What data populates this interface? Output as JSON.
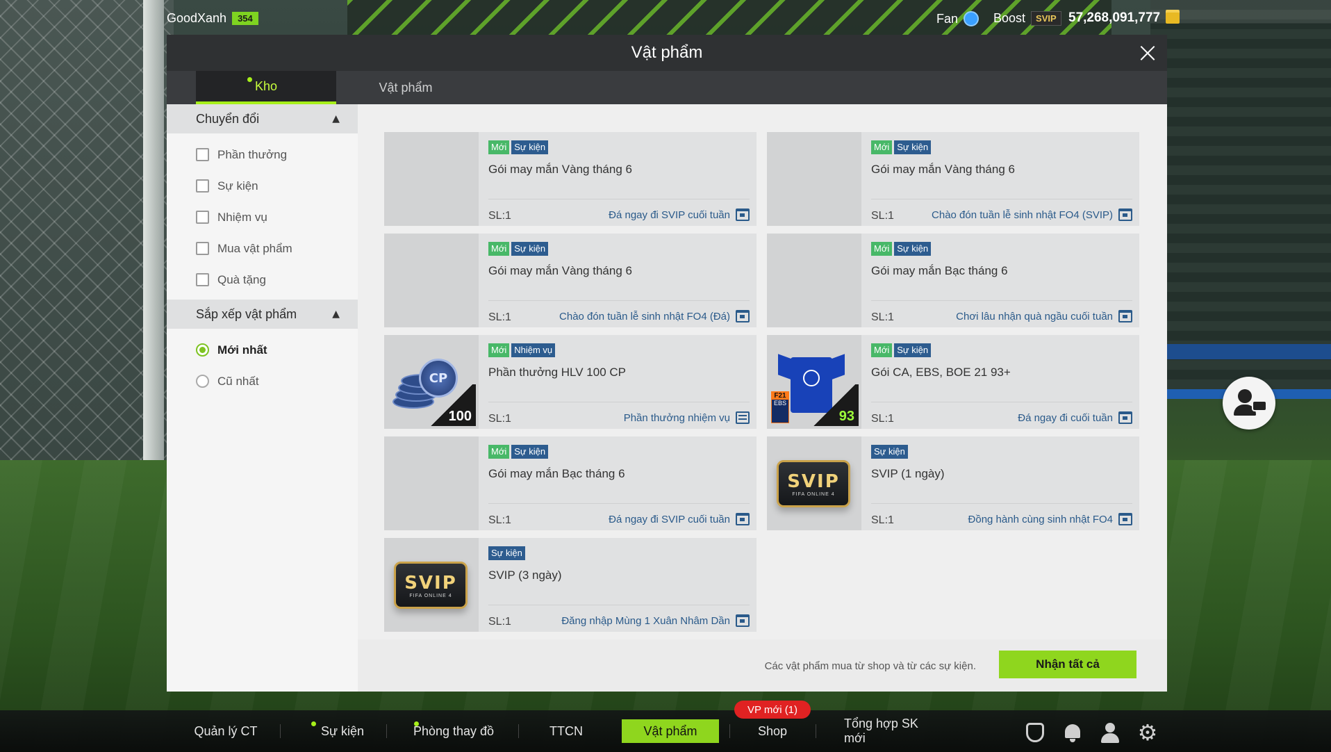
{
  "topbar": {
    "username": "GoodXanh",
    "level": "354",
    "fan_label": "Fan",
    "boost_label": "Boost",
    "boost_badge": "SVIP",
    "coins": "57,268,091,777"
  },
  "modal": {
    "title": "Vật phẩm",
    "close_icon": "close-icon",
    "tabs": [
      {
        "label": "Kho",
        "active": true,
        "has_dot": true
      },
      {
        "label": "Vật phẩm",
        "active": false
      }
    ]
  },
  "sidebar": {
    "filter_section": {
      "label": "Chuyển đổi",
      "options": [
        "Phần thưởng",
        "Sự kiện",
        "Nhiệm vụ",
        "Mua vật phẩm",
        "Quà tặng"
      ]
    },
    "sort_section": {
      "label": "Sắp xếp vật phẩm",
      "options": [
        "Mới nhất",
        "Cũ nhất"
      ],
      "selected": "Mới nhất"
    }
  },
  "tag_labels": {
    "new": "Mới",
    "event": "Sự kiện",
    "mission": "Nhiệm vụ"
  },
  "items": [
    {
      "tags": [
        "Mới",
        "Sự kiện"
      ],
      "title": "Gói may mắn Vàng tháng 6",
      "qty": "SL:1",
      "source": "Đá ngay đi SVIP cuối tuần",
      "thumb": "blank"
    },
    {
      "tags": [
        "Mới",
        "Sự kiện"
      ],
      "title": "Gói may mắn Vàng tháng 6",
      "qty": "SL:1",
      "source": "Chào đón tuần lễ sinh nhật FO4 (SVIP)",
      "thumb": "blank"
    },
    {
      "tags": [
        "Mới",
        "Sự kiện"
      ],
      "title": "Gói may mắn Vàng tháng 6",
      "qty": "SL:1",
      "source": "Chào đón tuần lễ sinh nhật FO4 (Đá)",
      "thumb": "blank"
    },
    {
      "tags": [
        "Mới",
        "Sự kiện"
      ],
      "title": "Gói may mắn Bạc tháng 6",
      "qty": "SL:1",
      "source": "Chơi lâu nhận quà ngầu cuối tuần",
      "thumb": "blank"
    },
    {
      "tags": [
        "Mới",
        "Nhiệm vụ"
      ],
      "title": "Phần thưởng HLV 100 CP",
      "qty": "SL:1",
      "source": "Phần thưởng nhiệm vụ",
      "thumb": "cp",
      "thumb_number": "100"
    },
    {
      "tags": [
        "Mới",
        "Sự kiện"
      ],
      "title": "Gói CA, EBS, BOE 21 93+",
      "qty": "SL:1",
      "source": "Đá ngay đi cuối tuần",
      "thumb": "shirt",
      "thumb_number": "93",
      "season": "F21",
      "season_sub": "EBS"
    },
    {
      "tags": [
        "Mới",
        "Sự kiện"
      ],
      "title": "Gói may mắn Bạc tháng 6",
      "qty": "SL:1",
      "source": "Đá ngay đi SVIP cuối tuần",
      "thumb": "blank"
    },
    {
      "tags": [
        "Sự kiện"
      ],
      "title": "SVIP (1 ngày)",
      "qty": "SL:1",
      "source": "Đồng hành cùng sinh nhật FO4",
      "thumb": "svip",
      "svip_text": "SVIP",
      "svip_sub": "FIFA ONLINE 4"
    },
    {
      "tags": [
        "Sự kiện"
      ],
      "title": "SVIP (3 ngày)",
      "qty": "SL:1",
      "source": "Đăng nhập Mùng 1 Xuân Nhâm Dần",
      "thumb": "svip",
      "svip_text": "SVIP",
      "svip_sub": "FIFA ONLINE 4"
    }
  ],
  "footer": {
    "note": "Các vật phẩm mua từ shop và từ các sự kiện.",
    "claim_all": "Nhận tất cả"
  },
  "bottom_nav": {
    "items": [
      "Quản lý CT",
      "Sự kiện",
      "Phòng thay đồ",
      "TTCN",
      "Vật phẩm",
      "Shop",
      "Tổng hợp SK mới"
    ],
    "active": "Vật phẩm",
    "badge": "VP mới (1)"
  },
  "colors": {
    "accent": "#8fd61e",
    "header_bg": "#2f3133",
    "tag_new": "#48b868",
    "tag_event": "#2d5c8f",
    "badge_red": "#e02222"
  }
}
